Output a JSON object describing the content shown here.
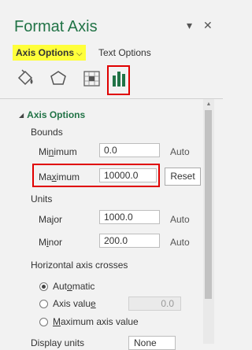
{
  "header": {
    "title": "Format Axis",
    "dropdown_glyph": "▾",
    "close_glyph": "✕"
  },
  "tabs": [
    {
      "label": "Axis Options",
      "active": true,
      "chevron": "⌵"
    },
    {
      "label": "Text Options",
      "active": false
    }
  ],
  "icons": [
    "fill-line-icon",
    "effects-icon",
    "size-properties-icon",
    "axis-options-chart-icon"
  ],
  "colors": {
    "accent": "#217346",
    "highlight": "#ffff3a",
    "callout": "#e00000"
  },
  "section": {
    "title": "Axis Options"
  },
  "bounds": {
    "label": "Bounds",
    "minimum": {
      "label_pre": "Mi",
      "label_u": "n",
      "label_post": "imum",
      "value": "0.0",
      "status": "Auto"
    },
    "maximum": {
      "label_pre": "Ma",
      "label_u": "x",
      "label_post": "imum",
      "value": "10000.0",
      "button": "Reset"
    }
  },
  "units": {
    "label": "Units",
    "major": {
      "label_pre": "Ma",
      "label_u": "j",
      "label_post": "or",
      "value": "1000.0",
      "status": "Auto"
    },
    "minor": {
      "label_pre": "M",
      "label_u": "i",
      "label_post": "nor",
      "value": "200.0",
      "status": "Auto"
    }
  },
  "crosses": {
    "label": "Horizontal axis crosses",
    "options": [
      {
        "label_pre": "Aut",
        "label_u": "o",
        "label_post": "matic",
        "selected": true
      },
      {
        "label_pre": "Axis valu",
        "label_u": "e",
        "label_post": "",
        "selected": false,
        "value": "0.0"
      },
      {
        "label_pre": "",
        "label_u": "M",
        "label_post": "aximum axis value",
        "selected": false
      }
    ]
  },
  "display_units": {
    "label": "Display units",
    "value": "None"
  }
}
